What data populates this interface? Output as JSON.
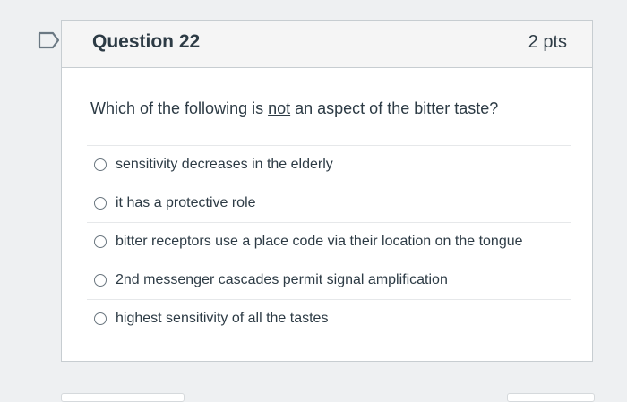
{
  "question": {
    "title": "Question 22",
    "points": "2 pts",
    "text_before": "Which of the following is ",
    "text_emphasis": "not",
    "text_after": " an aspect of the bitter taste?",
    "flag_icon": "flag-outline-icon"
  },
  "answers": [
    {
      "label": "sensitivity decreases in the elderly",
      "selected": false
    },
    {
      "label": "it has a protective role",
      "selected": false
    },
    {
      "label": "bitter receptors use a place code via their location on the tongue",
      "selected": false
    },
    {
      "label": "2nd messenger cascades permit signal amplification",
      "selected": false
    },
    {
      "label": "highest sensitivity of all the tastes",
      "selected": false
    }
  ],
  "colors": {
    "background": "#eef0f2",
    "text": "#2d3b45",
    "border": "#c7cdd1",
    "header_bg": "#f5f5f5"
  }
}
